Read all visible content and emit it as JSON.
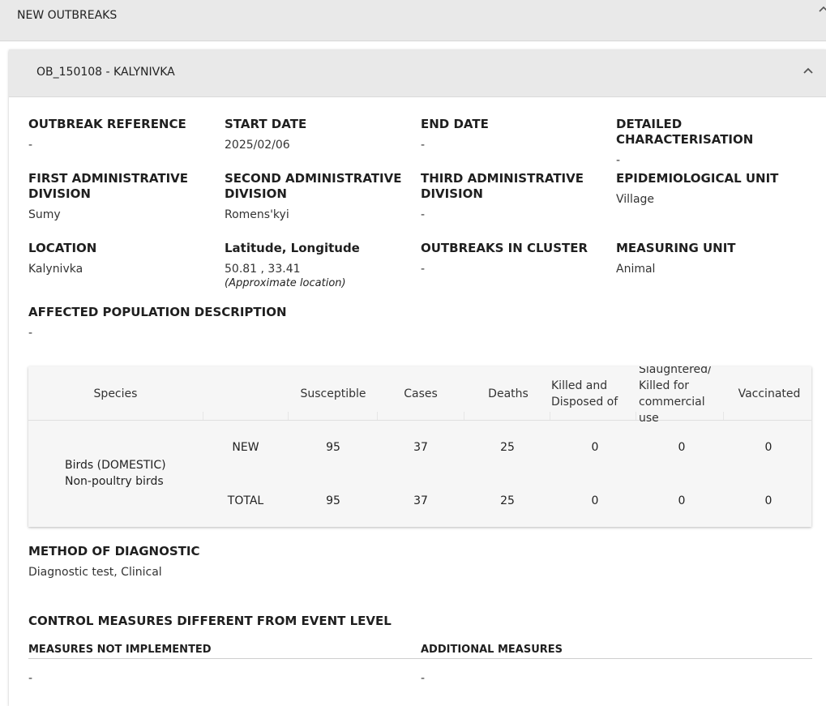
{
  "header": {
    "title": "NEW OUTBREAKS"
  },
  "outbreak": {
    "title": "OB_150108 - KALYNIVKA",
    "fields": {
      "outbreak_reference": {
        "label": "OUTBREAK REFERENCE",
        "value": "-"
      },
      "start_date": {
        "label": "START DATE",
        "value": "2025/02/06"
      },
      "end_date": {
        "label": "END DATE",
        "value": "-"
      },
      "detailed_characterisation": {
        "label": "DETAILED CHARACTERISATION",
        "value": "-"
      },
      "first_admin": {
        "label": "FIRST ADMINISTRATIVE DIVISION",
        "value": "Sumy"
      },
      "second_admin": {
        "label": "SECOND ADMINISTRATIVE DIVISION",
        "value": "Romens'kyi"
      },
      "third_admin": {
        "label": "THIRD ADMINISTRATIVE DIVISION",
        "value": "-"
      },
      "epi_unit": {
        "label": "EPIDEMIOLOGICAL UNIT",
        "value": "Village"
      },
      "location": {
        "label": "LOCATION",
        "value": "Kalynivka"
      },
      "latlon": {
        "label": "Latitude, Longitude",
        "value": "50.81 , 33.41",
        "note": "(Approximate location)"
      },
      "outbreaks_in_cluster": {
        "label": "OUTBREAKS IN CLUSTER",
        "value": "-"
      },
      "measuring_unit": {
        "label": "MEASURING UNIT",
        "value": "Animal"
      },
      "affected_population": {
        "label": "AFFECTED POPULATION DESCRIPTION",
        "value": "-"
      }
    },
    "table": {
      "headers": {
        "species": "Species",
        "susceptible": "Susceptible",
        "cases": "Cases",
        "deaths": "Deaths",
        "killed_disposed": "Killed and Disposed of",
        "slaughtered": "Slaughtered/ Killed for commercial use",
        "vaccinated": "Vaccinated"
      },
      "species_line1": "Birds (DOMESTIC)",
      "species_line2": "Non-poultry birds",
      "rows": [
        {
          "type": "NEW",
          "susceptible": "95",
          "cases": "37",
          "deaths": "25",
          "killed_disposed": "0",
          "slaughtered": "0",
          "vaccinated": "0"
        },
        {
          "type": "TOTAL",
          "susceptible": "95",
          "cases": "37",
          "deaths": "25",
          "killed_disposed": "0",
          "slaughtered": "0",
          "vaccinated": "0"
        }
      ]
    },
    "diagnostic": {
      "label": "METHOD OF DIAGNOSTIC",
      "value": "Diagnostic test, Clinical"
    },
    "control": {
      "title": "CONTROL MEASURES DIFFERENT FROM EVENT LEVEL",
      "not_implemented_label": "MEASURES NOT IMPLEMENTED",
      "not_implemented_value": "-",
      "additional_label": "ADDITIONAL MEASURES",
      "additional_value": "-"
    }
  }
}
